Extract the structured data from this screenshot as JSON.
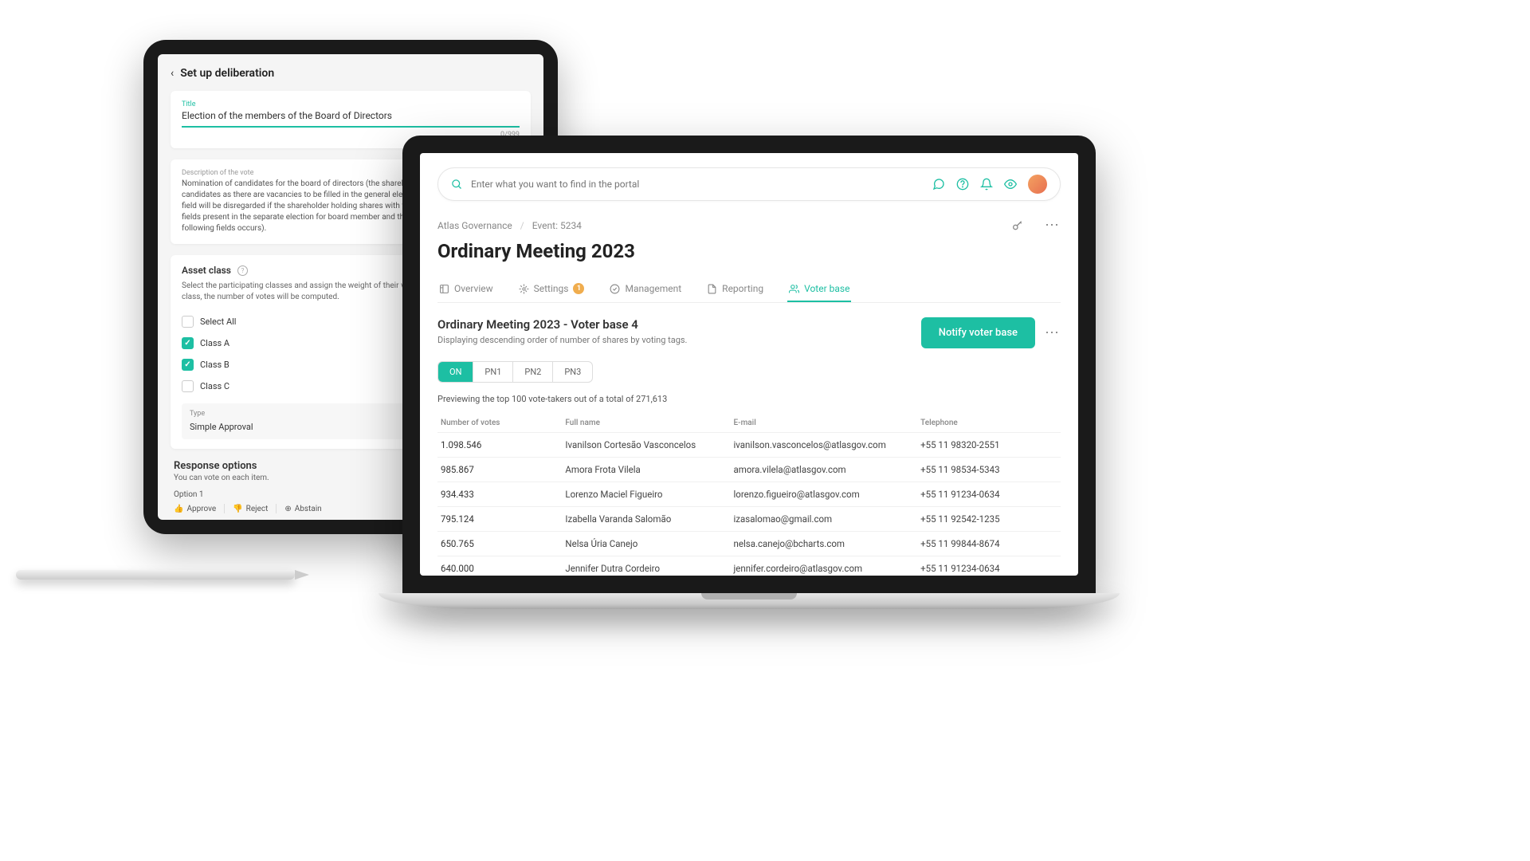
{
  "tablet": {
    "headerTitle": "Set up deliberation",
    "titleLabel": "Title",
    "titleValue": "Election of the members of the Board of Directors",
    "charCount": "0/999",
    "descLabel": "Description of the vote",
    "descText": "Nomination of candidates for the board of directors (the shareholder may nominate as many candidates as there are vacancies to be filled in the general election. The votes indicated in this field will be disregarded if the shareholder holding shares with voting rights also fills in the fields present in the separate election for board member and the separate election of the following fields occurs).",
    "assetClassTitle": "Asset class",
    "assetClassDesc": "Select the participating classes and assign the weight of their votes. For each asset in the class, the number of votes will be computed.",
    "selectAll": "Select All",
    "classes": [
      {
        "name": "Class A",
        "checked": true
      },
      {
        "name": "Class B",
        "checked": true
      },
      {
        "name": "Class C",
        "checked": false
      }
    ],
    "typeLabel": "Type",
    "typeValue": "Simple Approval",
    "responseTitle": "Response options",
    "responseSub": "You can vote on each item.",
    "optionLabel": "Option 1",
    "approve": "Approve",
    "reject": "Reject",
    "abstain": "Abstain"
  },
  "laptop": {
    "searchPlaceholder": "Enter what you want to find in the portal",
    "crumb1": "Atlas Governance",
    "crumb2": "Event: 5234",
    "pageTitle": "Ordinary Meeting 2023",
    "tabs": {
      "overview": "Overview",
      "settings": "Settings",
      "settingsBadge": "1",
      "management": "Management",
      "reporting": "Reporting",
      "voterbase": "Voter base"
    },
    "subTitle": "Ordinary Meeting 2023 - Voter base 4",
    "subDesc": "Displaying descending order of number of shares by voting tags.",
    "notifyBtn": "Notify voter base",
    "pills": [
      "ON",
      "PN1",
      "PN2",
      "PN3"
    ],
    "previewNote": "Previewing the top 100 vote-takers out of a total of 271,613",
    "columns": {
      "votes": "Number of votes",
      "name": "Full name",
      "email": "E-mail",
      "phone": "Telephone"
    },
    "rows": [
      {
        "votes": "1.098.546",
        "name": "Ivanilson Cortesão Vasconcelos",
        "email": "ivanilson.vasconcelos@atlasgov.com",
        "phone": "+55 11 98320-2551"
      },
      {
        "votes": "985.867",
        "name": "Amora Frota Vilela",
        "email": "amora.vilela@atlasgov.com",
        "phone": "+55 11 98534-5343"
      },
      {
        "votes": "934.433",
        "name": "Lorenzo Maciel Figueiro",
        "email": "lorenzo.figueiro@atlasgov.com",
        "phone": "+55 11 91234-0634"
      },
      {
        "votes": "795.124",
        "name": "Izabella Varanda Salomão",
        "email": "izasalomao@gmail.com",
        "phone": "+55 11 92542-1235"
      },
      {
        "votes": "650.765",
        "name": "Nelsa Úria Canejo",
        "email": "nelsa.canejo@bcharts.com",
        "phone": "+55 11 99844-8674"
      },
      {
        "votes": "640.000",
        "name": "Jennifer Dutra Cordeiro",
        "email": "jennifer.cordeiro@atlasgov.com",
        "phone": "+55 11 91234-0634"
      }
    ]
  }
}
